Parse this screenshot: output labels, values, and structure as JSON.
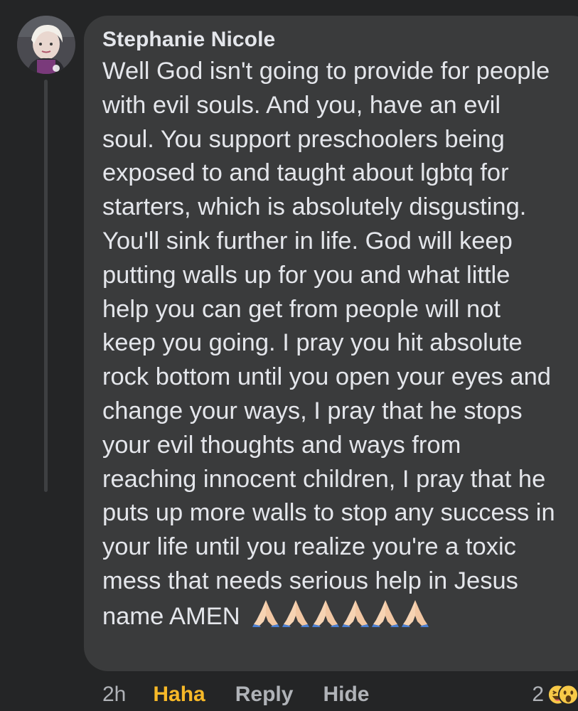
{
  "comment": {
    "author": "Stephanie Nicole",
    "text": "Well God isn't going to provide for people with evil souls. And you, have an evil soul. You support preschoolers being exposed to and taught about lgbtq for starters, which is absolutely disgusting. You'll sink further in life. God will keep putting walls up for you and what little help you can get from people will not keep you going. I pray you hit absolute rock bottom until you open your eyes and change your ways, I pray that he stops your evil thoughts and ways from reaching innocent children, I pray that he puts up more walls to stop any success in your life until you realize you're a toxic mess that needs serious help in Jesus name AMEN",
    "emojis": [
      "folded-hands-icon",
      "folded-hands-icon",
      "folded-hands-icon",
      "folded-hands-icon",
      "folded-hands-icon",
      "folded-hands-icon"
    ]
  },
  "actions": {
    "time": "2h",
    "haha_label": "Haha",
    "reply_label": "Reply",
    "hide_label": "Hide"
  },
  "reactions": {
    "count": "2",
    "icons": [
      "haha-reaction-icon",
      "wow-reaction-icon"
    ]
  },
  "colors": {
    "background": "#242526",
    "bubble": "#3a3b3c",
    "text": "#e4e6eb",
    "muted": "#b0b3b8",
    "haha_active": "#f7b928",
    "thread_line": "#3e4042"
  }
}
